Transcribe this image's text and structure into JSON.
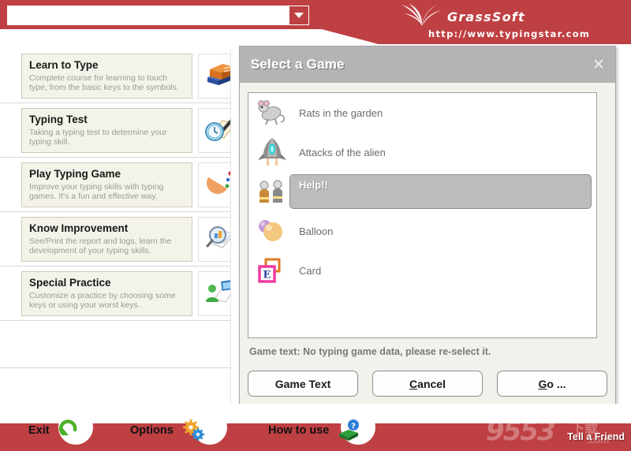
{
  "header": {
    "combo_value": "",
    "combo_placeholder": "",
    "dropdown_icon": "chevron-down-icon",
    "brand_name": "GrassSoft",
    "brand_url": "http://www.typingstar.com",
    "brand_color": "#bf4043"
  },
  "menu": {
    "items": [
      {
        "title": "Learn to Type",
        "desc": "Complete course for learning to touch type, from the basic keys to the symbols.",
        "icon": "books-icon"
      },
      {
        "title": "Typing Test",
        "desc": "Taking a typing test to determine your typing skill.",
        "icon": "clock-pencil-icon"
      },
      {
        "title": "Play Typing Game",
        "desc": "Improve your typing skills with typing games. It's a fun and effective way.",
        "icon": "pacman-icon"
      },
      {
        "title": "Know Improvement",
        "desc": "See/Print the report and logs, learn the development of your typing skills.",
        "icon": "magnifier-report-icon"
      },
      {
        "title": "Special Practice",
        "desc": "Customize a practice by choosing some keys or using your worst keys.",
        "icon": "user-laptop-icon"
      }
    ]
  },
  "dialog": {
    "title": "Select a Game",
    "close_icon": "close-icon",
    "games": [
      {
        "label": "Rats in the garden",
        "icon": "rat-icon",
        "selected": false
      },
      {
        "label": "Attacks of the alien",
        "icon": "spaceship-icon",
        "selected": false
      },
      {
        "label": "Help!!",
        "icon": "firefighters-icon",
        "selected": true
      },
      {
        "label": "Balloon",
        "icon": "balloons-icon",
        "selected": false
      },
      {
        "label": "Card",
        "icon": "card-e-icon",
        "selected": false
      }
    ],
    "status_text": "Game text: No typing game data, please re-select it.",
    "buttons": [
      {
        "label": "Game Text",
        "mnemonic": "",
        "name": "game-text-button"
      },
      {
        "label": "ancel",
        "mnemonic": "C",
        "name": "cancel-button"
      },
      {
        "label": "o ...",
        "mnemonic": "G",
        "name": "go-button"
      }
    ],
    "selected_bg": "#bcbcbc",
    "titlebar_bg": "#b4b4b4"
  },
  "bottom": {
    "items": [
      {
        "label": "Exit",
        "icon": "refresh-arrow-icon"
      },
      {
        "label": "Options",
        "icon": "gears-icon"
      },
      {
        "label": "How to use",
        "icon": "help-book-icon"
      }
    ],
    "tell_a_friend": "Tell a Friend",
    "watermark_number": "9553",
    "watermark_cn": "下载",
    "watermark_com": ".com"
  }
}
